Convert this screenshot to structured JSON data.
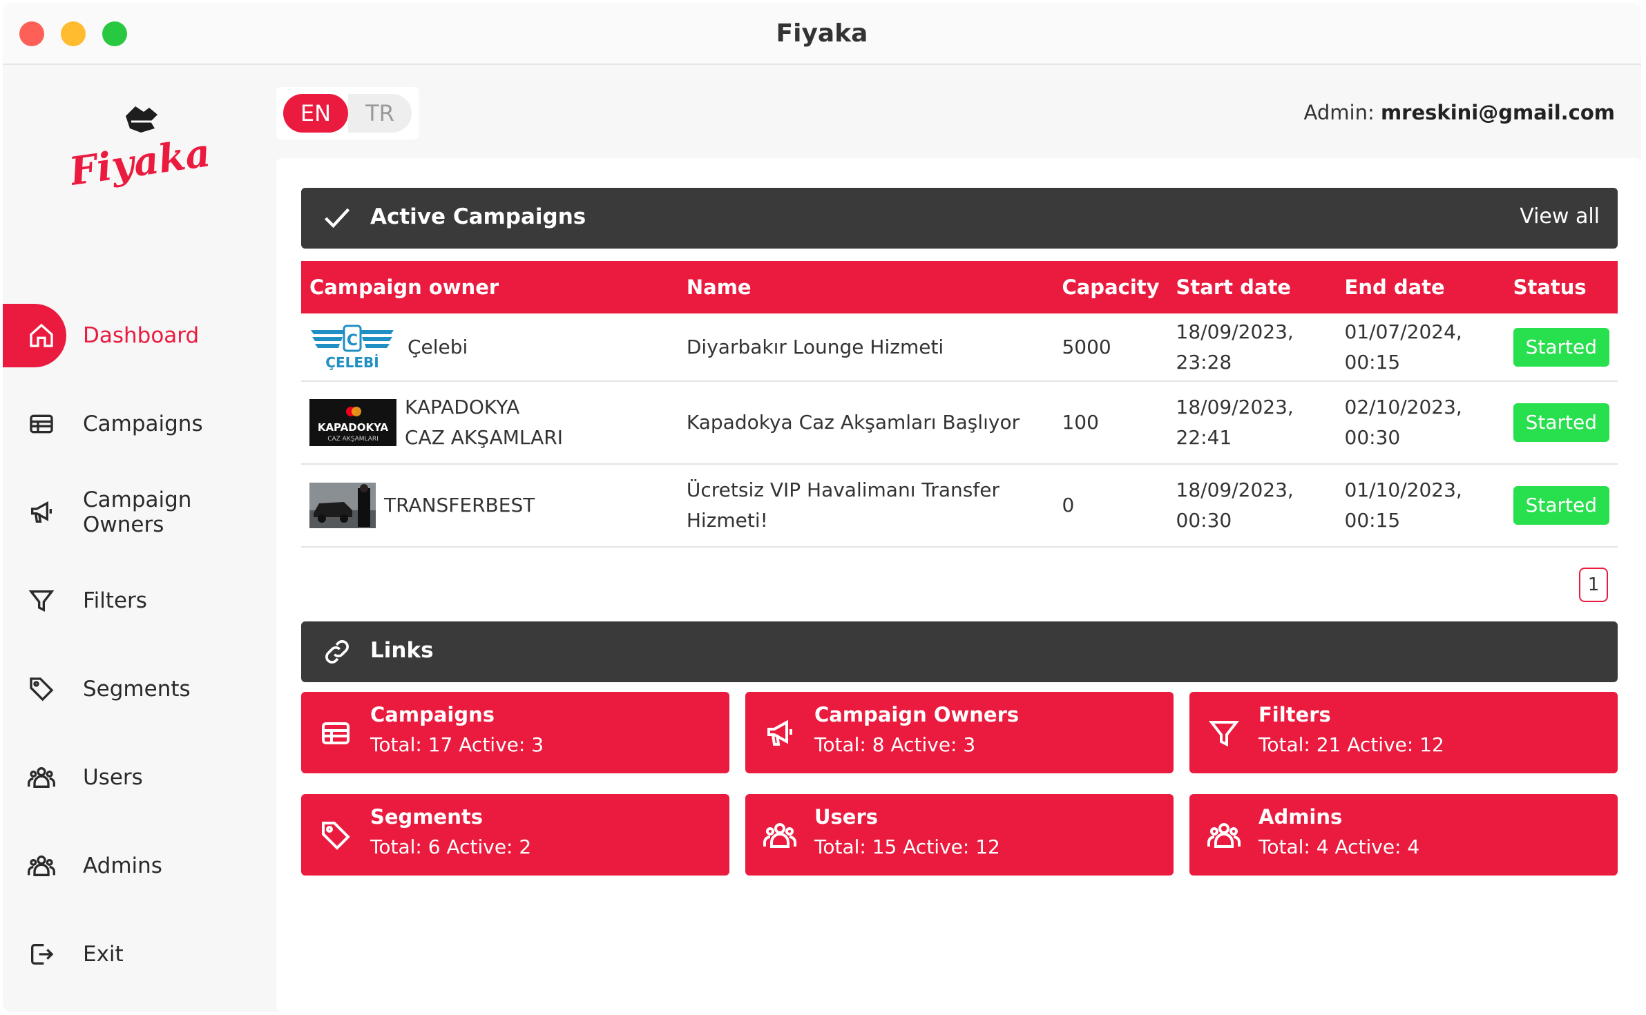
{
  "window": {
    "title": "Fiyaka"
  },
  "brand": {
    "logo_text": "Fiyaka",
    "accent": "#ea1b3e",
    "dark": "#3a3a3a",
    "success": "#28df4e"
  },
  "sidebar": {
    "items": [
      {
        "label": "Dashboard",
        "icon": "home-icon",
        "active": true
      },
      {
        "label": "Campaigns",
        "icon": "table-icon"
      },
      {
        "label": "Campaign Owners",
        "icon": "megaphone-icon"
      },
      {
        "label": "Filters",
        "icon": "filter-icon"
      },
      {
        "label": "Segments",
        "icon": "tag-icon"
      },
      {
        "label": "Users",
        "icon": "users-icon"
      },
      {
        "label": "Admins",
        "icon": "users-icon"
      },
      {
        "label": "Exit",
        "icon": "logout-icon"
      }
    ]
  },
  "header": {
    "languages": [
      "EN",
      "TR"
    ],
    "selected_language": "EN",
    "admin_label": "Admin:",
    "admin_email": "mreskini@gmail.com"
  },
  "active_campaigns": {
    "title": "Active Campaigns",
    "view_all": "View all",
    "columns": [
      "Campaign owner",
      "Name",
      "Capacity",
      "Start date",
      "End date",
      "Status"
    ],
    "rows": [
      {
        "owner": "Çelebi",
        "owner_logo_text": "ÇELEBİ",
        "name": "Diyarbakır Lounge Hizmeti",
        "capacity": "5000",
        "start": "18/09/2023, 23:28",
        "end": "01/07/2024, 00:15",
        "status": "Started"
      },
      {
        "owner": "KAPADOKYA CAZ AKŞAMLARI",
        "owner_logo_text": "KAPADOKYA",
        "owner_logo_subtext": "CAZ AKŞAMLARI",
        "name": "Kapadokya Caz Akşamları Başlıyor",
        "capacity": "100",
        "start": "18/09/2023, 22:41",
        "end": "02/10/2023, 00:30",
        "status": "Started"
      },
      {
        "owner": "TRANSFERBEST",
        "name": "Ücretsiz VIP Havalimanı Transfer Hizmeti!",
        "capacity": "0",
        "start": "18/09/2023, 00:30",
        "end": "01/10/2023, 00:15",
        "status": "Started"
      }
    ],
    "pagination": {
      "current_page": "1"
    }
  },
  "links": {
    "title": "Links",
    "cards": [
      {
        "title": "Campaigns",
        "stats": "Total: 17  Active: 3",
        "icon": "table-icon"
      },
      {
        "title": "Campaign Owners",
        "stats": "Total: 8  Active: 3",
        "icon": "megaphone-icon"
      },
      {
        "title": "Filters",
        "stats": "Total: 21  Active: 12",
        "icon": "filter-icon"
      },
      {
        "title": "Segments",
        "stats": "Total: 6  Active: 2",
        "icon": "tag-icon"
      },
      {
        "title": "Users",
        "stats": "Total: 15  Active: 12",
        "icon": "users-icon"
      },
      {
        "title": "Admins",
        "stats": "Total: 4  Active: 4",
        "icon": "users-icon"
      }
    ]
  }
}
